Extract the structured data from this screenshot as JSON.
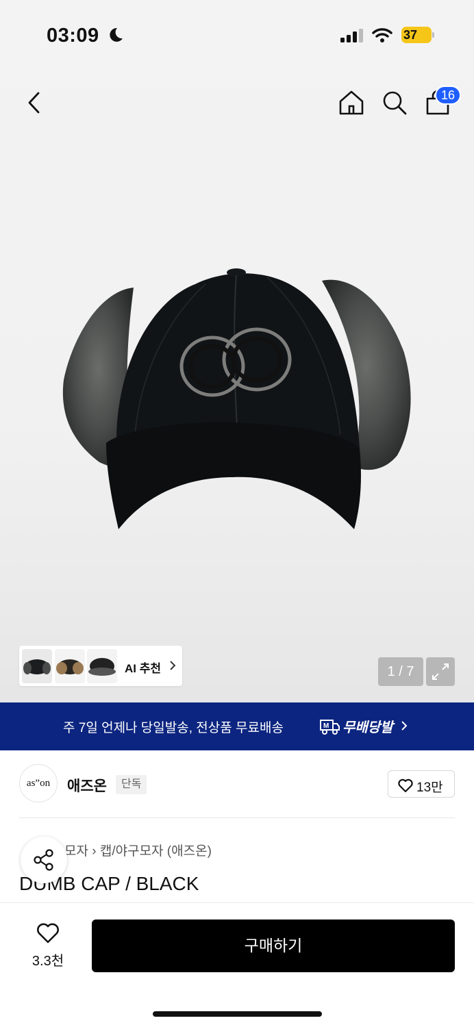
{
  "status_bar": {
    "time": "03:09",
    "battery": "37"
  },
  "header": {
    "cart_count": "16"
  },
  "gallery": {
    "ai_label": "AI 추천",
    "counter": "1 / 7"
  },
  "banner": {
    "text": "주 7일 언제나 당일발송, 전상품 무료배송",
    "brand": "무배당발"
  },
  "brand": {
    "logo_text": "as”on",
    "name": "애즈온",
    "badge": "단독",
    "likes": "13만"
  },
  "breadcrumb": "모자 › 캡/야구모자 (애즈온)",
  "product": {
    "title": "DUMB CAP / BLACK"
  },
  "bottom": {
    "wish_count": "3.3천",
    "buy_label": "구매하기"
  }
}
